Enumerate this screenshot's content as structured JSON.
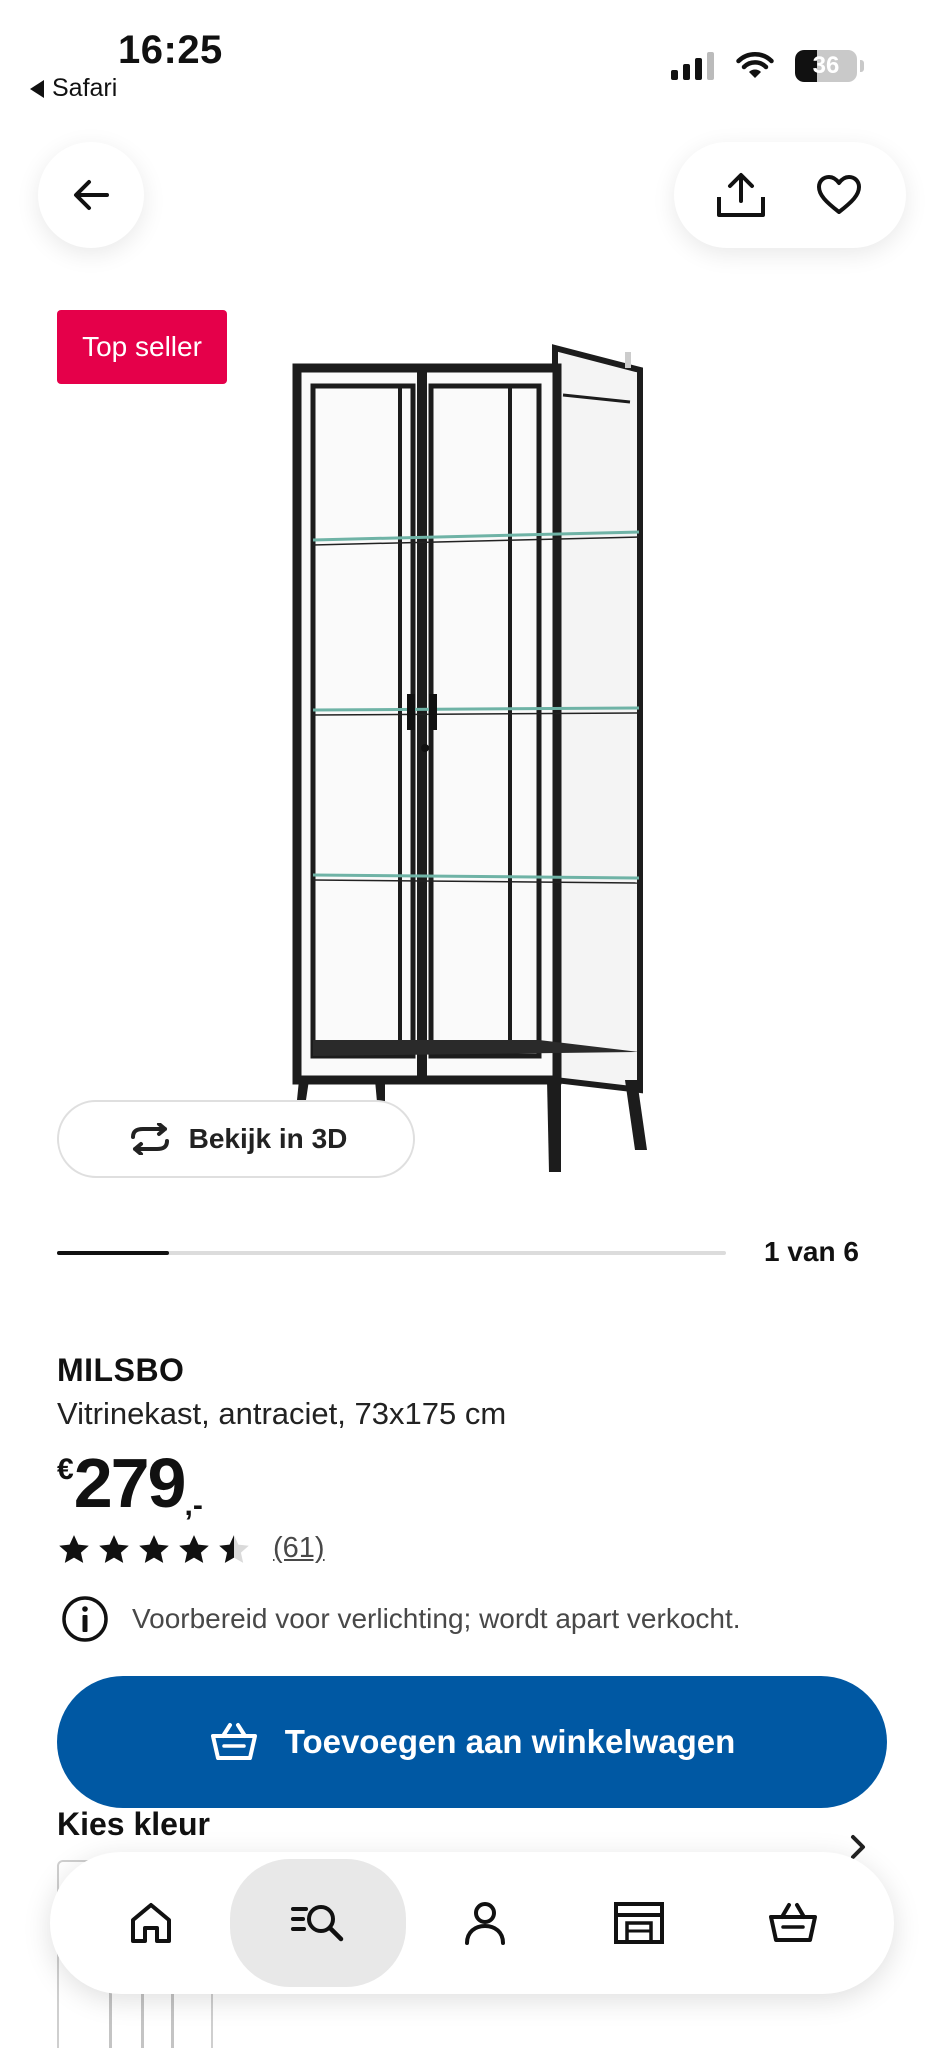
{
  "status_bar": {
    "time": "16:25",
    "back_app": "Safari",
    "battery": "36",
    "battery_level": 0.36
  },
  "header": {
    "back_icon": "arrow-left-icon",
    "share_icon": "share-icon",
    "favorite_icon": "heart-icon"
  },
  "badge": {
    "label": "Top seller",
    "color": "#e5004a"
  },
  "gallery": {
    "view_3d_label": "Bekijk in 3D",
    "position_label": "1 van 6",
    "current": 1,
    "total": 6
  },
  "product": {
    "name": "MILSBO",
    "description": "Vitrinekast, antraciet, 73x175 cm",
    "currency": "€",
    "price": "279",
    "price_decimals": ",-",
    "rating": 4.5,
    "rating_count": "(61)",
    "info_text": "Voorbereid voor verlichting; wordt apart verkocht."
  },
  "actions": {
    "add_to_cart_label": "Toevoegen aan winkelwagen",
    "cart_button_color": "#0058a3"
  },
  "color_section": {
    "title": "Kies kleur"
  },
  "tab_bar": {
    "items": [
      {
        "icon": "home-icon",
        "active": false
      },
      {
        "icon": "search-icon",
        "active": true
      },
      {
        "icon": "profile-icon",
        "active": false
      },
      {
        "icon": "store-icon",
        "active": false
      },
      {
        "icon": "cart-icon",
        "active": false
      }
    ]
  }
}
